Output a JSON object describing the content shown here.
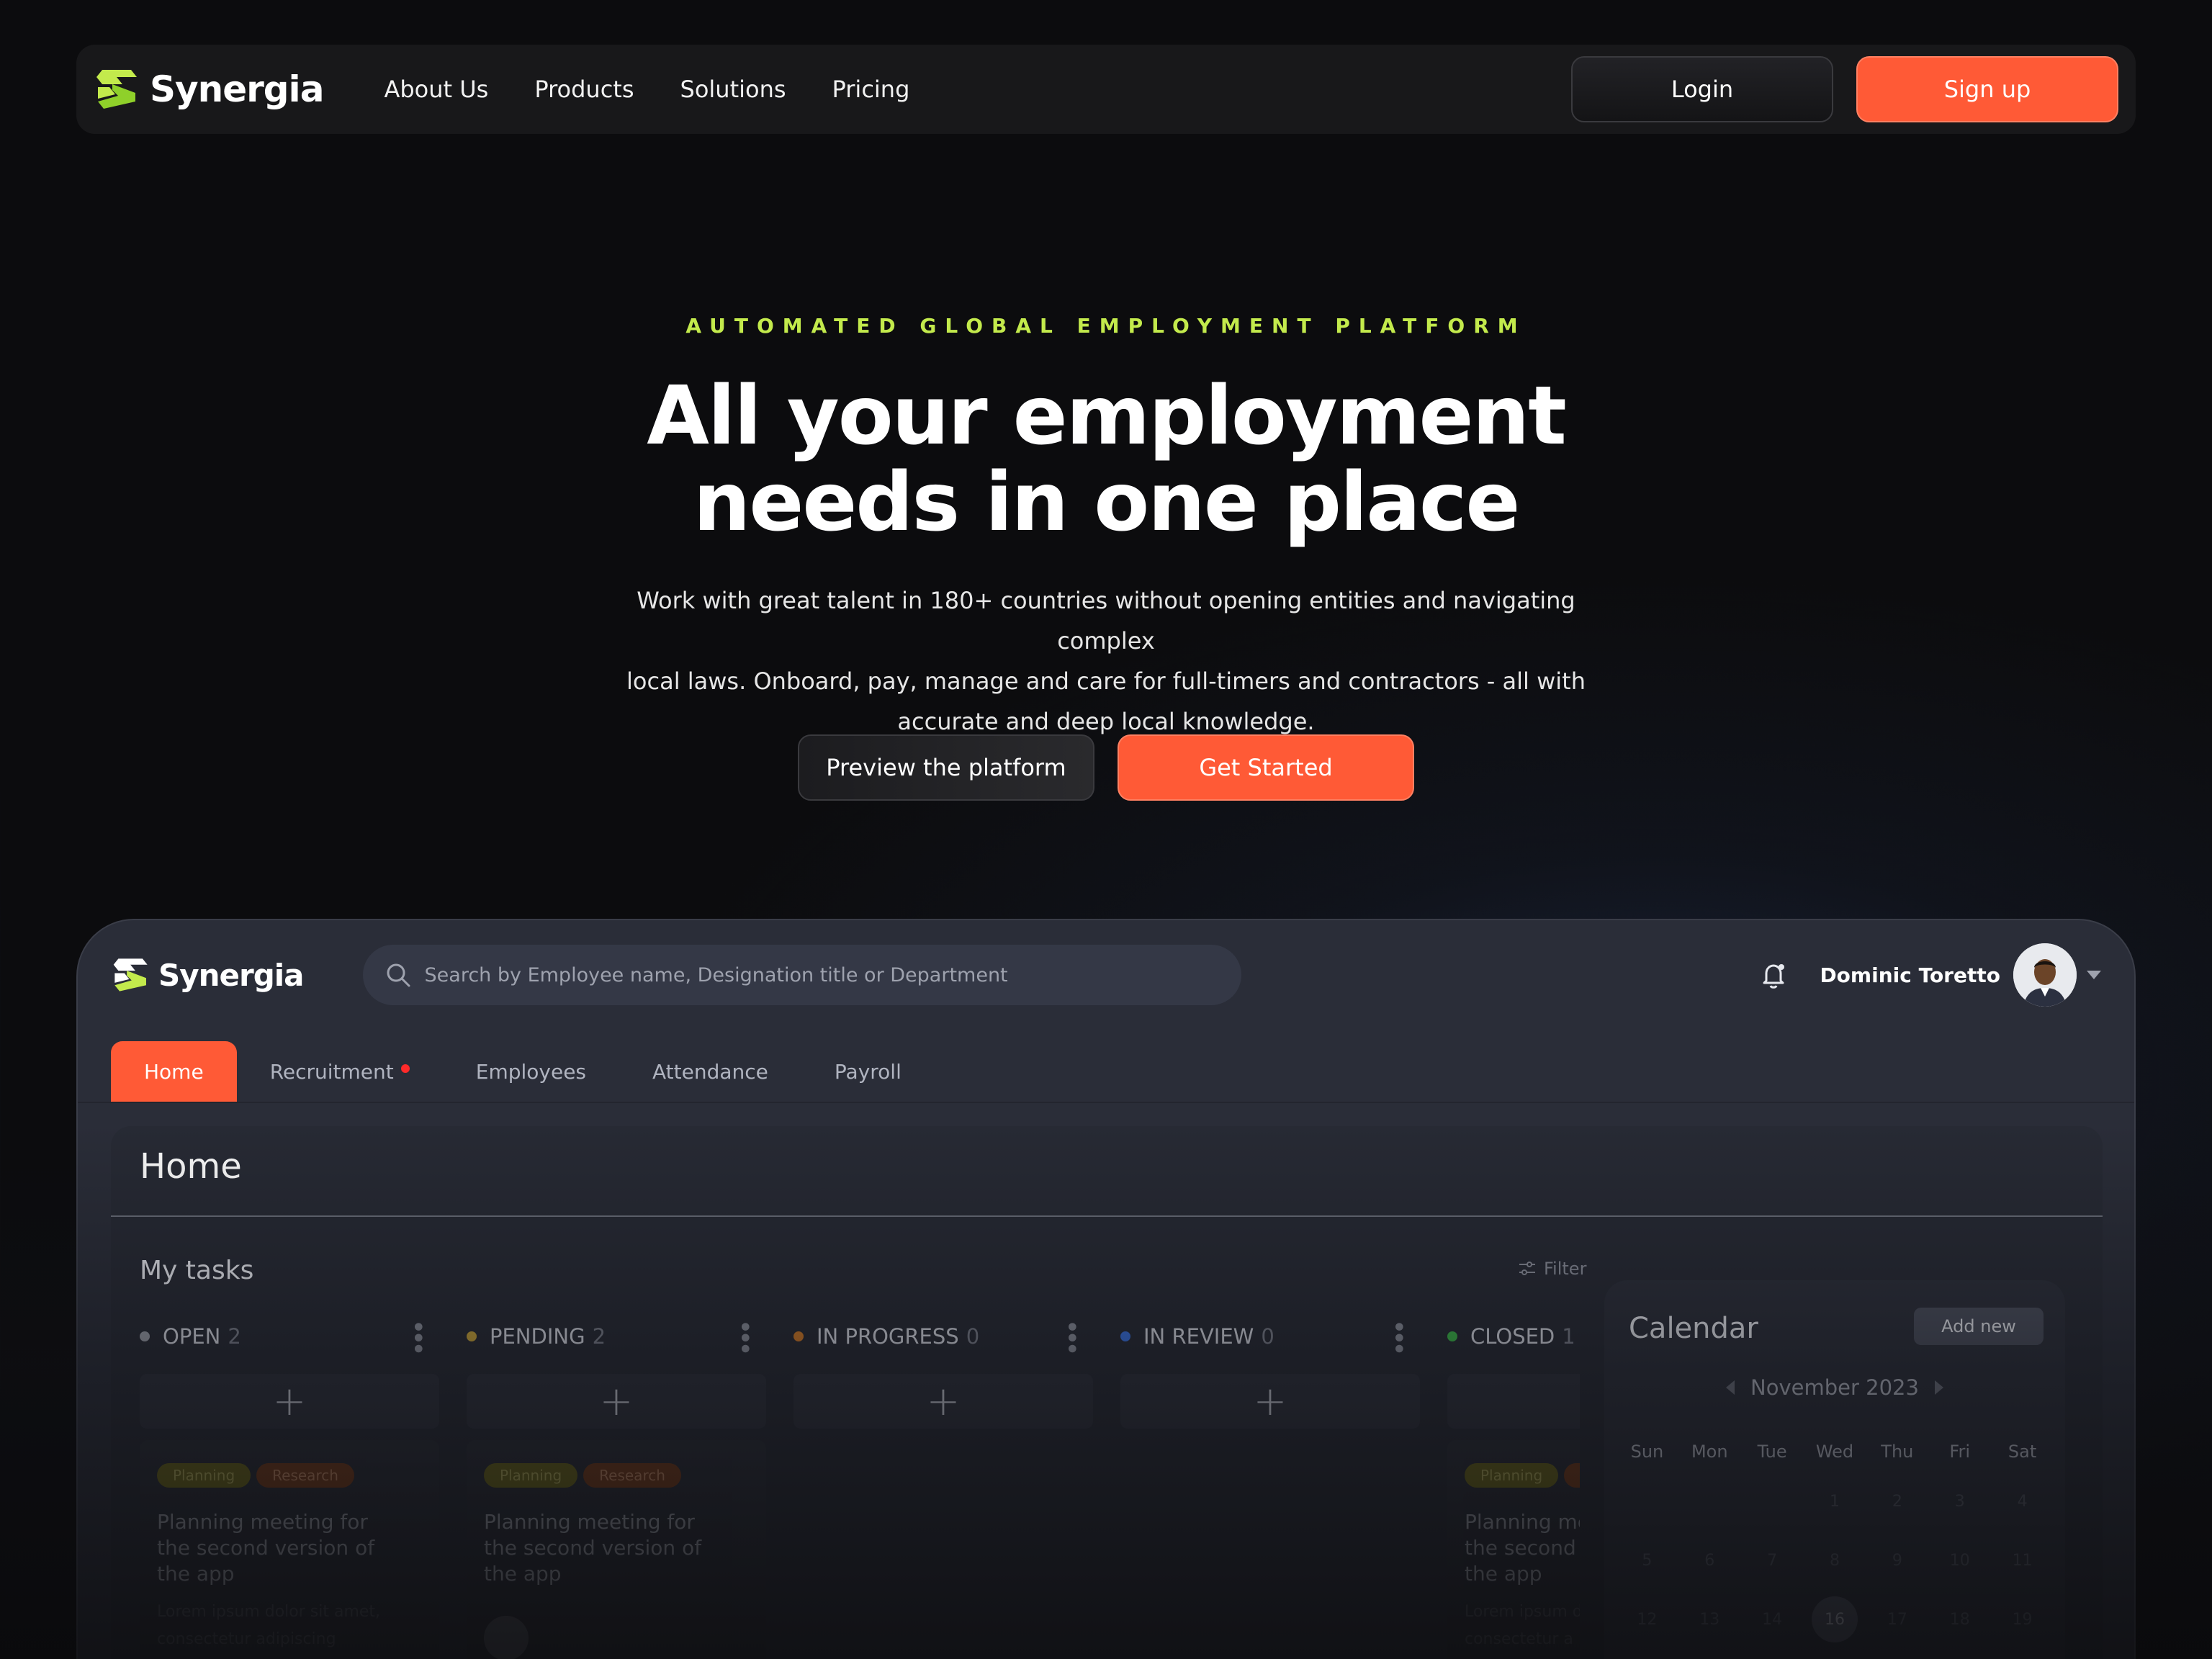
{
  "colors": {
    "accent": "#ff5a36",
    "brand_green": "#c3ea4c",
    "background": "#0c0c0e"
  },
  "nav": {
    "brand": "Synergia",
    "links": [
      "About Us",
      "Products",
      "Solutions",
      "Pricing"
    ],
    "login": "Login",
    "signup": "Sign up"
  },
  "hero": {
    "eyebrow": "AUTOMATED GLOBAL EMPLOYMENT PLATFORM",
    "title_lines": [
      "All your employment",
      "needs in one place"
    ],
    "subtitle_lines": [
      "Work with great talent in 180+ countries without opening entities and navigating complex",
      "local laws. Onboard, pay, manage and care for full-timers and contractors - all with",
      "accurate and deep local knowledge."
    ],
    "preview_button": "Preview the platform",
    "start_button": "Get Started"
  },
  "dashboard": {
    "brand": "Synergia",
    "search_placeholder": "Search by Employee name, Designation title or Department",
    "user_name": "Dominic Toretto",
    "tabs": [
      "Home",
      "Recruitment",
      "Employees",
      "Attendance",
      "Payroll"
    ],
    "page_title": "Home",
    "tasks_title": "My tasks",
    "filter_label": "Filter",
    "columns": [
      {
        "label": "OPEN",
        "count": "2",
        "color": "#9a9ea8"
      },
      {
        "label": "PENDING",
        "count": "2",
        "color": "#c8a43a"
      },
      {
        "label": "IN PROGRESS",
        "count": "0",
        "color": "#d07a28"
      },
      {
        "label": "IN REVIEW",
        "count": "0",
        "color": "#3a72e0"
      },
      {
        "label": "CLOSED",
        "count": "1",
        "color": "#3cb84a"
      }
    ],
    "card": {
      "tags": [
        "Planning",
        "Research"
      ],
      "title_lines": [
        "Planning meeting for",
        "the second version of",
        "the app"
      ],
      "title_lines_cut": [
        "Planning me",
        "the second v",
        "the app"
      ],
      "desc_lines": [
        "Lorem ipsum dolor sit amet,",
        "consectetur adipiscing"
      ],
      "desc_lines_cut": [
        "Lorem ipsum d",
        "consectetur a"
      ]
    },
    "calendar": {
      "title": "Calendar",
      "add_button": "Add new",
      "month": "November 2023",
      "weekdays": [
        "Sun",
        "Mon",
        "Tue",
        "Wed",
        "Thu",
        "Fri",
        "Sat"
      ],
      "week1": [
        "",
        "",
        "",
        "1",
        "2",
        "3",
        "4"
      ],
      "week2": [
        "5",
        "6",
        "7",
        "8",
        "9",
        "10",
        "11"
      ],
      "week3": [
        "12",
        "13",
        "14",
        "16",
        "17",
        "18",
        "19"
      ],
      "today": "16"
    }
  }
}
